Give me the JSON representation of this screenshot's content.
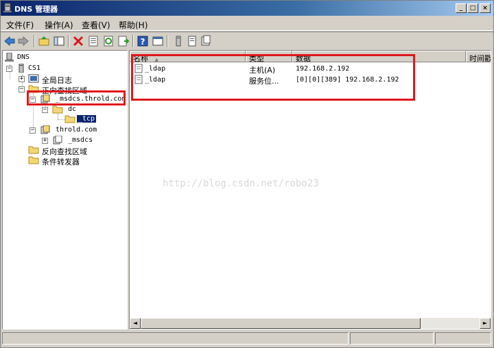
{
  "window": {
    "title": "DNS 管理器",
    "controls": {
      "minimize": "_",
      "maximize": "□",
      "close": "×"
    }
  },
  "menu": [
    {
      "label": "文件(F)"
    },
    {
      "label": "操作(A)"
    },
    {
      "label": "查看(V)"
    },
    {
      "label": "帮助(H)"
    }
  ],
  "toolbar": [
    "back-arrow-icon",
    "forward-arrow-icon",
    "up-folder-icon",
    "show-hide-tree-icon",
    "delete-icon",
    "properties-icon",
    "refresh-icon",
    "export-list-icon",
    "help-icon",
    "console-icon",
    "server-icon",
    "list-icon",
    "zone-icon"
  ],
  "tree": {
    "root": "DNS",
    "server": "CS1",
    "global_logs": "全局日志",
    "forward_zones": "正向查找区域",
    "msdcs_zone": "_msdcs.throld.com",
    "dc": "dc",
    "tcp": "_tcp",
    "throld_zone": "throld.com",
    "msdcs_sub": "_msdcs",
    "reverse_zones": "反向查找区域",
    "conditional_forwarders": "条件转发器",
    "expanders": {
      "collapse": "−",
      "expand": "+"
    }
  },
  "list": {
    "columns": [
      {
        "label": "名称"
      },
      {
        "label": "类型"
      },
      {
        "label": "数据"
      },
      {
        "label": "时间戳"
      }
    ],
    "rows": [
      {
        "name": "_ldap",
        "type": "主机(A)",
        "data": "192.168.2.192"
      },
      {
        "name": "_ldap",
        "type": "服务位...",
        "data": "[0][0][389] 192.168.2.192"
      }
    ],
    "sort_indicator": "▲"
  },
  "scrollbar": {
    "left": "◄",
    "right": "►"
  },
  "watermark": "http://blog.csdn.net/robo23",
  "colors": {
    "highlight": "#e0161b",
    "selection": "#0a246a"
  }
}
